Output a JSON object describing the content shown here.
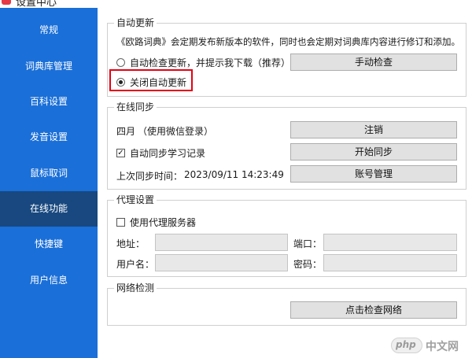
{
  "window": {
    "title": "设置中心"
  },
  "sidebar": {
    "items": [
      {
        "label": "常规"
      },
      {
        "label": "词典库管理"
      },
      {
        "label": "百科设置"
      },
      {
        "label": "发音设置"
      },
      {
        "label": "鼠标取词"
      },
      {
        "label": "在线功能",
        "active": true
      },
      {
        "label": "快捷键"
      },
      {
        "label": "用户信息"
      }
    ]
  },
  "auto_update": {
    "legend": "自动更新",
    "description": "《欧路词典》会定期发布新版本的软件，同时也会定期对词典库内容进行修订和添加。",
    "option_auto": "自动检查更新，并提示我下载（推荐）",
    "option_off": "关闭自动更新",
    "selected": "option_off",
    "manual_check_button": "手动检查"
  },
  "online_sync": {
    "legend": "在线同步",
    "user": "四月",
    "login_method": "（使用微信登录）",
    "logout_button": "注销",
    "auto_sync_label": "自动同步学习记录",
    "auto_sync_checked": true,
    "start_sync_button": "开始同步",
    "last_sync_label": "上次同步时间：",
    "last_sync_time": "2023/09/11 14:23:49",
    "account_button": "账号管理"
  },
  "proxy": {
    "legend": "代理设置",
    "use_proxy_label": "使用代理服务器",
    "use_proxy_checked": false,
    "address_label": "地址：",
    "address_value": "",
    "port_label": "端口：",
    "port_value": "",
    "username_label": "用户名：",
    "username_value": "",
    "password_label": "密码：",
    "password_value": ""
  },
  "network_check": {
    "legend": "网络检测",
    "check_button": "点击检查网络"
  },
  "watermark": {
    "brand": "php",
    "text": "中文网"
  },
  "colors": {
    "sidebar": "#1a6fd8",
    "sidebar_active": "#18487f",
    "highlight": "#e60012"
  }
}
